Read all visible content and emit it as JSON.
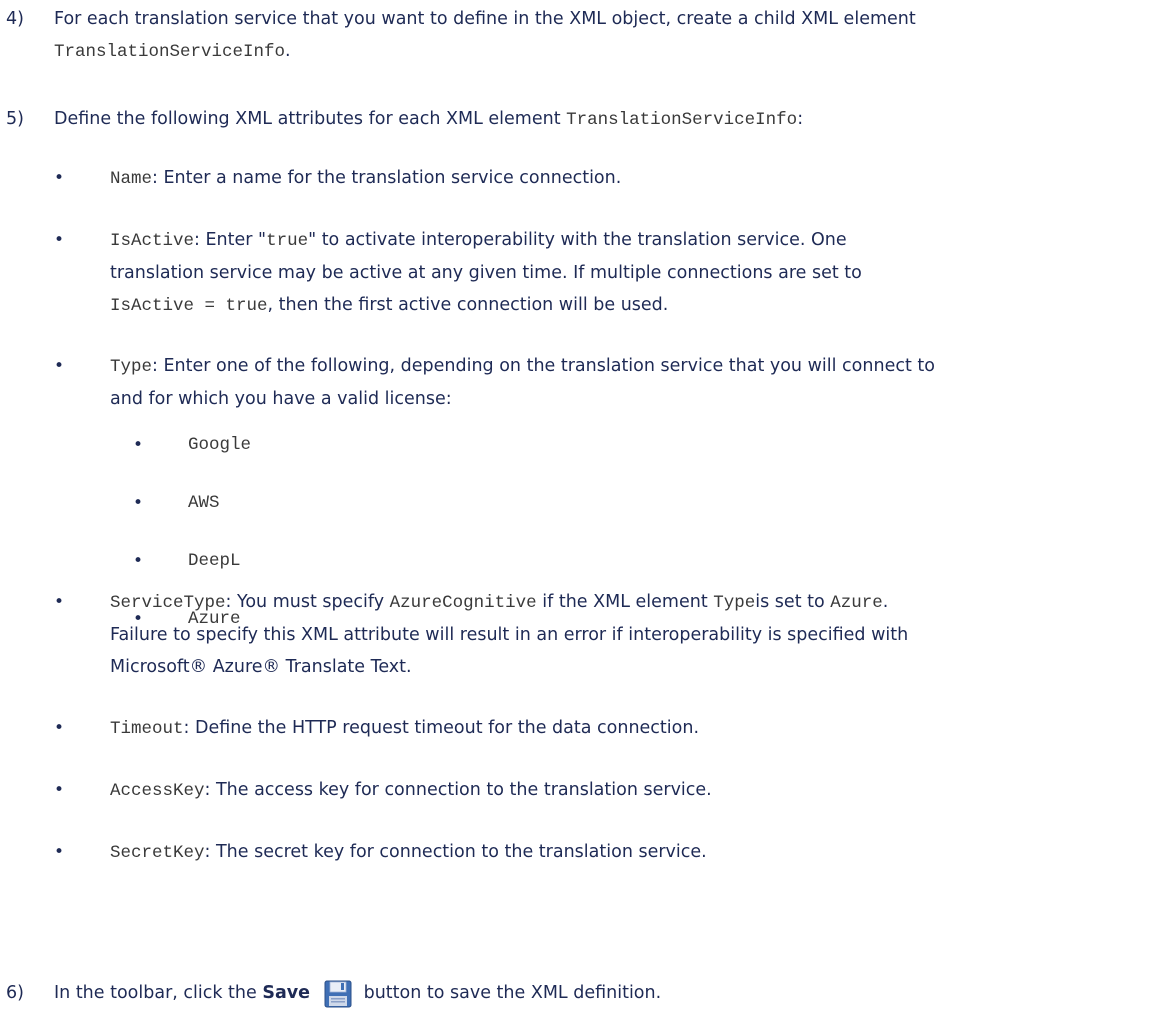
{
  "step4": {
    "num": "4)",
    "text_a": "For each translation service that you want to define in the XML object, create a child XML element",
    "code": "TranslationServiceInfo",
    "text_b": "."
  },
  "step5": {
    "num": "5)",
    "text_a": "Define the following XML attributes for each XML element ",
    "code": "TranslationServiceInfo",
    "text_b": ":"
  },
  "attributes": {
    "name": {
      "code": "Name",
      "desc": ": Enter a name for the translation service connection."
    },
    "isactive": {
      "code": "IsActive",
      "desc_a": ": Enter \"",
      "code_true": "true",
      "desc_b": "\" to activate interoperability with the translation service. One",
      "line2": "translation service may be active at any given time. If multiple connections are set to",
      "code_line3": "IsActive = true",
      "line3_b": ", then the first active connection will be used."
    },
    "type": {
      "code": "Type",
      "desc": ": Enter one of the following, depending on the translation service that you will connect to",
      "line2": "and for which you have a valid license:",
      "options": [
        "Google",
        "AWS",
        "DeepL",
        "Azure"
      ]
    },
    "servicetype": {
      "code": "ServiceType",
      "desc_a": ": You must specify ",
      "code_azurecog": "AzureCognitive",
      "desc_b": " if the XML element ",
      "code_type": "Type",
      "desc_c": "is set to ",
      "code_azure": "Azure",
      "desc_d": ".",
      "line2": "Failure to specify this XML attribute will result in an error if interoperability is specified with",
      "line3": "Microsoft® Azure® Translate Text."
    },
    "timeout": {
      "code": "Timeout",
      "desc": ": Define the HTTP request timeout for the data connection."
    },
    "accesskey": {
      "code": "AccessKey",
      "desc": ": The access key for connection to the translation service."
    },
    "secretkey": {
      "code": "SecretKey",
      "desc": ": The secret key for connection to the translation service."
    }
  },
  "step6": {
    "num": "6)",
    "text_a": "In the toolbar, click the ",
    "bold": "Save",
    "icon": "floppy-disk-save-icon",
    "text_b": " button to save the XML definition."
  },
  "colors": {
    "text": "#1e2a55",
    "code": "#3a3a3a",
    "icon_blue": "#3f6fb5"
  }
}
